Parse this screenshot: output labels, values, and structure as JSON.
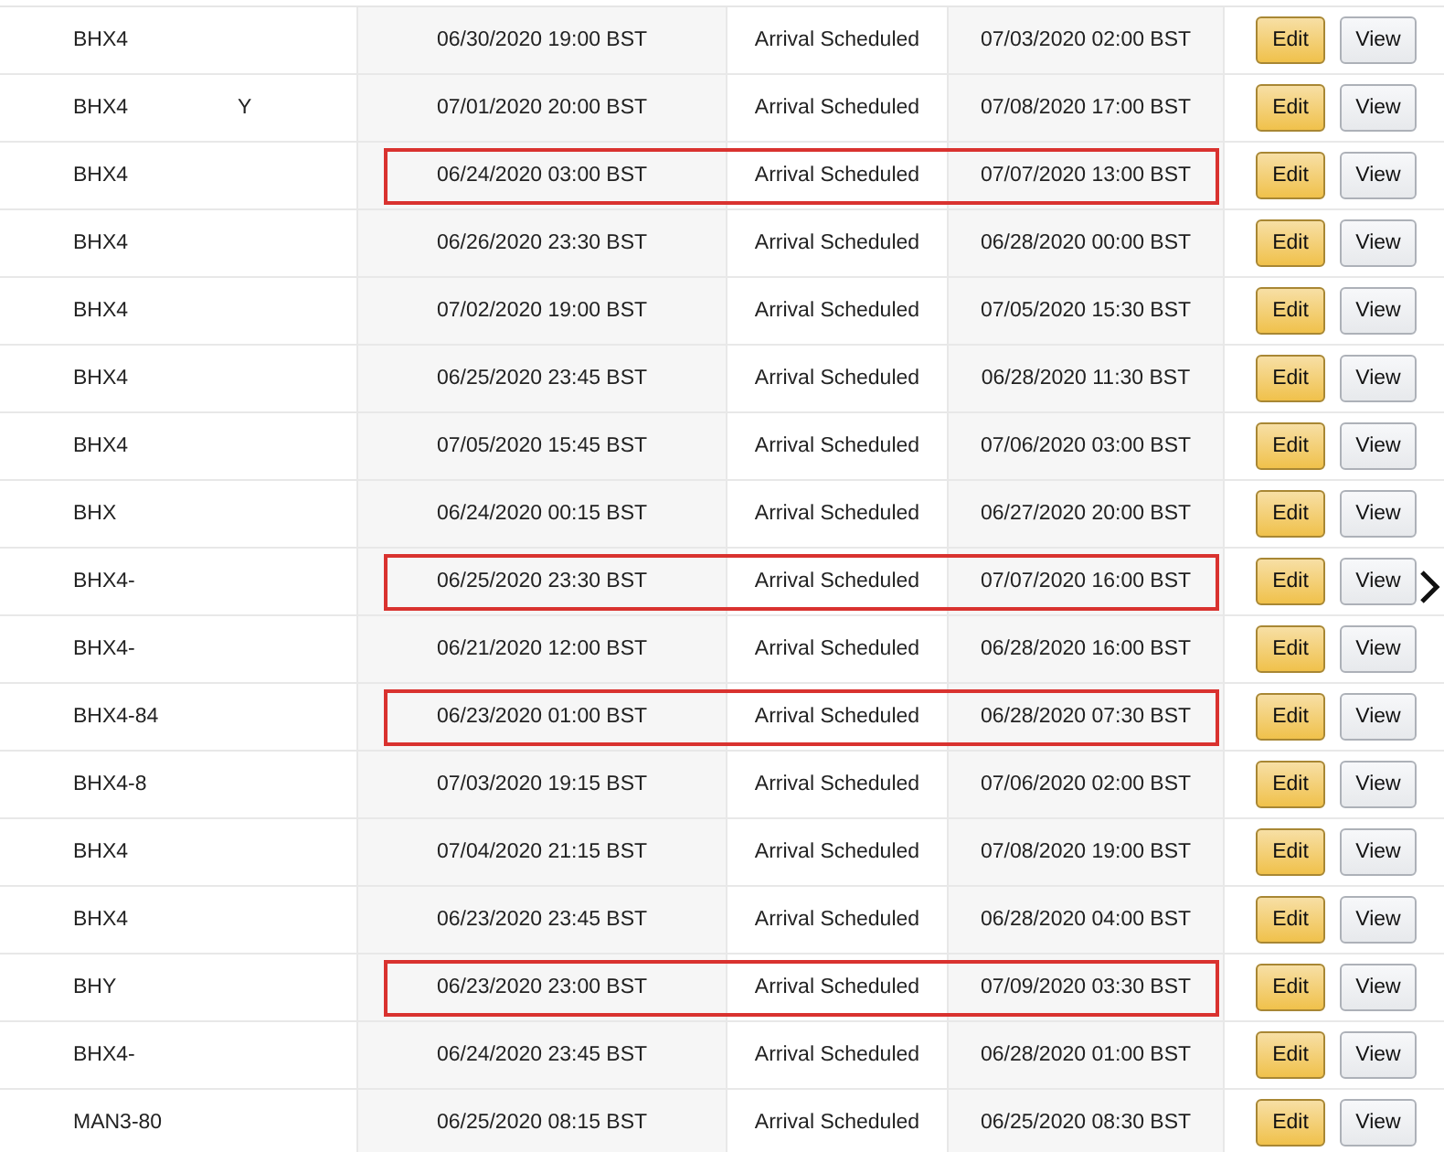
{
  "rows": [
    {
      "shipment": "BHX4",
      "shipment_suffix": "",
      "created": "06/30/2020 19:00 BST",
      "status": "Arrival Scheduled",
      "arrival": "07/03/2020 02:00 BST",
      "highlighted": false,
      "actions": [
        "Edit",
        "View"
      ]
    },
    {
      "shipment": "BHX4",
      "shipment_suffix": "Y",
      "created": "07/01/2020 20:00 BST",
      "status": "Arrival Scheduled",
      "arrival": "07/08/2020 17:00 BST",
      "highlighted": false,
      "actions": [
        "Edit",
        "View"
      ]
    },
    {
      "shipment": "BHX4",
      "shipment_suffix": "",
      "created": "06/24/2020 03:00 BST",
      "status": "Arrival Scheduled",
      "arrival": "07/07/2020 13:00 BST",
      "highlighted": true,
      "actions": [
        "Edit",
        "View"
      ]
    },
    {
      "shipment": "BHX4",
      "shipment_suffix": "",
      "created": "06/26/2020 23:30 BST",
      "status": "Arrival Scheduled",
      "arrival": "06/28/2020 00:00 BST",
      "highlighted": false,
      "actions": [
        "Edit",
        "View"
      ]
    },
    {
      "shipment": "BHX4",
      "shipment_suffix": "",
      "created": "07/02/2020 19:00 BST",
      "status": "Arrival Scheduled",
      "arrival": "07/05/2020 15:30 BST",
      "highlighted": false,
      "actions": [
        "Edit",
        "View"
      ]
    },
    {
      "shipment": "BHX4",
      "shipment_suffix": "",
      "created": "06/25/2020 23:45 BST",
      "status": "Arrival Scheduled",
      "arrival": "06/28/2020 11:30 BST",
      "highlighted": false,
      "actions": [
        "Edit",
        "View"
      ]
    },
    {
      "shipment": "BHX4",
      "shipment_suffix": "",
      "created": "07/05/2020 15:45 BST",
      "status": "Arrival Scheduled",
      "arrival": "07/06/2020 03:00 BST",
      "highlighted": false,
      "actions": [
        "Edit",
        "View"
      ]
    },
    {
      "shipment": "BHX",
      "shipment_suffix": "",
      "created": "06/24/2020 00:15 BST",
      "status": "Arrival Scheduled",
      "arrival": "06/27/2020 20:00 BST",
      "highlighted": false,
      "actions": [
        "Edit",
        "View"
      ]
    },
    {
      "shipment": "BHX4-",
      "shipment_suffix": "",
      "created": "06/25/2020 23:30 BST",
      "status": "Arrival Scheduled",
      "arrival": "07/07/2020 16:00 BST",
      "highlighted": true,
      "actions": [
        "Edit",
        "View"
      ]
    },
    {
      "shipment": "BHX4-",
      "shipment_suffix": "",
      "created": "06/21/2020 12:00 BST",
      "status": "Arrival Scheduled",
      "arrival": "06/28/2020 16:00 BST",
      "highlighted": false,
      "actions": [
        "Edit",
        "View"
      ]
    },
    {
      "shipment": "BHX4-84",
      "shipment_suffix": "",
      "created": "06/23/2020 01:00 BST",
      "status": "Arrival Scheduled",
      "arrival": "06/28/2020 07:30 BST",
      "highlighted": true,
      "actions": [
        "Edit",
        "View"
      ]
    },
    {
      "shipment": "BHX4-8",
      "shipment_suffix": "",
      "created": "07/03/2020 19:15 BST",
      "status": "Arrival Scheduled",
      "arrival": "07/06/2020 02:00 BST",
      "highlighted": false,
      "actions": [
        "Edit",
        "View"
      ]
    },
    {
      "shipment": "BHX4",
      "shipment_suffix": "",
      "created": "07/04/2020 21:15 BST",
      "status": "Arrival Scheduled",
      "arrival": "07/08/2020 19:00 BST",
      "highlighted": false,
      "actions": [
        "Edit",
        "View"
      ]
    },
    {
      "shipment": "BHX4",
      "shipment_suffix": "",
      "created": "06/23/2020 23:45 BST",
      "status": "Arrival Scheduled",
      "arrival": "06/28/2020 04:00 BST",
      "highlighted": false,
      "actions": [
        "Edit",
        "View"
      ]
    },
    {
      "shipment": "BHY",
      "shipment_suffix": "",
      "created": "06/23/2020 23:00 BST",
      "status": "Arrival Scheduled",
      "arrival": "07/09/2020 03:30 BST",
      "highlighted": true,
      "actions": [
        "Edit",
        "View"
      ]
    },
    {
      "shipment": "BHX4-",
      "shipment_suffix": "",
      "created": "06/24/2020 23:45 BST",
      "status": "Arrival Scheduled",
      "arrival": "06/28/2020 01:00 BST",
      "highlighted": false,
      "actions": [
        "Edit",
        "View"
      ]
    },
    {
      "shipment": "MAN3-80",
      "shipment_suffix": "",
      "created": "06/25/2020 08:15 BST",
      "status": "Arrival Scheduled",
      "arrival": "06/25/2020 08:30 BST",
      "highlighted": false,
      "actions": [
        "Edit",
        "View"
      ]
    }
  ]
}
